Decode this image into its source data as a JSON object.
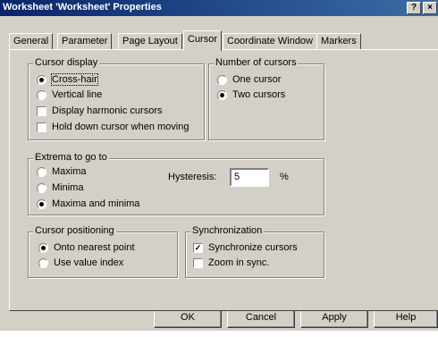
{
  "window": {
    "title": "Worksheet 'Worksheet' Properties",
    "help_label": "?",
    "close_label": "×"
  },
  "tabs": [
    {
      "label": "General"
    },
    {
      "label": "Parameter"
    },
    {
      "label": "Page Layout"
    },
    {
      "label": "Cursor",
      "active": true
    },
    {
      "label": "Coordinate Window"
    },
    {
      "label": "Markers"
    }
  ],
  "cursor_display": {
    "legend": "Cursor display",
    "options": [
      {
        "label": "Cross-hair",
        "type": "radio",
        "checked": true
      },
      {
        "label": "Vertical line",
        "type": "radio",
        "checked": false
      },
      {
        "label": "Display harmonic cursors",
        "type": "checkbox",
        "checked": false
      },
      {
        "label": "Hold down cursor when moving",
        "type": "checkbox",
        "checked": false
      }
    ]
  },
  "number_of_cursors": {
    "legend": "Number of cursors",
    "options": [
      {
        "label": "One cursor",
        "checked": false
      },
      {
        "label": "Two cursors",
        "checked": true
      }
    ]
  },
  "extrema": {
    "legend": "Extrema to go to",
    "options": [
      {
        "label": "Maxima",
        "checked": false
      },
      {
        "label": "Minima",
        "checked": false
      },
      {
        "label": "Maxima and minima",
        "checked": true
      }
    ],
    "hysteresis_label": "Hysteresis:",
    "hysteresis_value": "5",
    "unit": "%"
  },
  "cursor_positioning": {
    "legend": "Cursor positioning",
    "options": [
      {
        "label": "Onto nearest point",
        "checked": true
      },
      {
        "label": "Use value index",
        "checked": false
      }
    ]
  },
  "synchronization": {
    "legend": "Synchronization",
    "options": [
      {
        "label": "Synchronize cursors",
        "checked": true
      },
      {
        "label": "Zoom in sync.",
        "checked": false
      }
    ]
  },
  "buttons": {
    "ok": "OK",
    "cancel": "Cancel",
    "apply": "Apply",
    "help": "Help"
  }
}
